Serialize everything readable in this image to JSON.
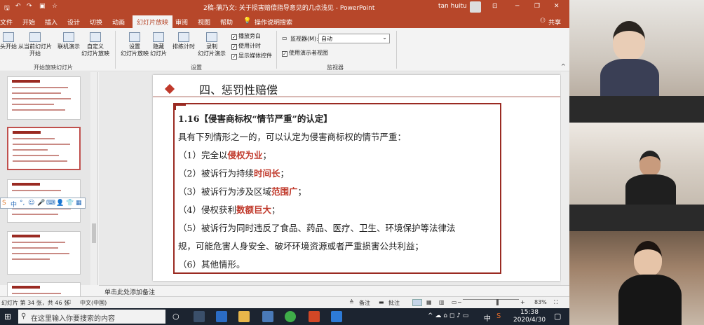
{
  "titlebar": {
    "save_icon": "save-icon",
    "undo_icon": "undo-icon",
    "redo_icon": "redo-icon",
    "start_icon": "start-from-beginning-icon",
    "doc_title": "2稿-蒲乃文: 关于损害赔偿指导意见的几点浅见 - PowerPoint",
    "user": "tan huitu",
    "minimize": "─",
    "restore": "❐",
    "close": "✕"
  },
  "menu": {
    "file": "文件",
    "home": "开始",
    "insert": "插入",
    "design": "设计",
    "transitions": "切换",
    "animations": "动画",
    "slideshow": "幻灯片放映",
    "review": "审阅",
    "view": "视图",
    "help": "帮助",
    "tellme": "操作说明搜索",
    "share": "共享"
  },
  "ribbon": {
    "from_beginning": "头开始",
    "from_current": "从当前幻灯片\n开始",
    "online": "联机演示",
    "custom": "自定义\n幻灯片放映",
    "group_start": "开始放映幻灯片",
    "setup": "设置\n幻灯片放映",
    "hide": "隐藏\n幻灯片",
    "rehearse": "排练计时",
    "record": "录制\n幻灯片演示",
    "play_narrations": "播放旁白",
    "use_timings": "使用计时",
    "show_media": "显示媒体控件",
    "group_setup": "设置",
    "monitor_label": "监视器(M):",
    "monitor_value": "自动",
    "presenter_view": "使用演示者视图",
    "group_monitors": "监视器"
  },
  "floatbar": {
    "items": [
      "中",
      "°,",
      "☺",
      "🎤",
      "⌨",
      "👤",
      "👕",
      "▦"
    ]
  },
  "slide": {
    "heading": "四、惩罚性赔偿",
    "subheading": "1.16【侵害商标权“情节严重”的认定】",
    "intro": "具有下列情形之一的，可以认定为侵害商标权的情节严重：",
    "item1_pre": "（1）完全以",
    "item1_hl": "侵权为业",
    "item1_post": "；",
    "item2_pre": "（2）被诉行为持续",
    "item2_hl": "时间长",
    "item2_post": "；",
    "item3_pre": "（3）被诉行为涉及区域",
    "item3_hl": "范围广",
    "item3_post": "；",
    "item4_pre": "（4）侵权获利",
    "item4_hl": "数额巨大",
    "item4_post": "；",
    "item5_line1": "（5）被诉行为同时违反了食品、药品、医疗、卫生、环境保护等法律法",
    "item5_line2": "规，可能危害人身安全、破坏环境资源或者严重损害公共利益；",
    "item6": "（6）其他情形。"
  },
  "notes": {
    "placeholder": "单击此处添加备注"
  },
  "status": {
    "slide_info": "幻灯片 第 34 张，共 46 张",
    "language": "中文(中国)",
    "notes_btn": "备注",
    "comments_btn": "批注",
    "zoom": "83%",
    "zoom_minus": "−",
    "zoom_plus": "+"
  },
  "taskbar": {
    "search_placeholder": "在这里输入你要搜索的内容",
    "time": "15:38",
    "date": "2020/4/30",
    "ime": "中",
    "ime_s": "S"
  },
  "colors": {
    "accent": "#b7472a",
    "highlight": "#c0392b",
    "frame": "#9a2a22"
  }
}
